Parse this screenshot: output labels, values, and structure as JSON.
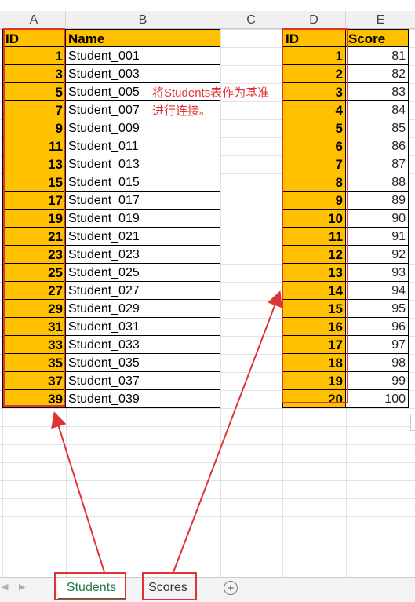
{
  "columns": [
    "A",
    "B",
    "C",
    "D",
    "E"
  ],
  "students": {
    "header_id": "ID",
    "header_name": "Name",
    "rows": [
      {
        "id": "1",
        "name": "Student_001"
      },
      {
        "id": "3",
        "name": "Student_003"
      },
      {
        "id": "5",
        "name": "Student_005"
      },
      {
        "id": "7",
        "name": "Student_007"
      },
      {
        "id": "9",
        "name": "Student_009"
      },
      {
        "id": "11",
        "name": "Student_011"
      },
      {
        "id": "13",
        "name": "Student_013"
      },
      {
        "id": "15",
        "name": "Student_015"
      },
      {
        "id": "17",
        "name": "Student_017"
      },
      {
        "id": "19",
        "name": "Student_019"
      },
      {
        "id": "21",
        "name": "Student_021"
      },
      {
        "id": "23",
        "name": "Student_023"
      },
      {
        "id": "25",
        "name": "Student_025"
      },
      {
        "id": "27",
        "name": "Student_027"
      },
      {
        "id": "29",
        "name": "Student_029"
      },
      {
        "id": "31",
        "name": "Student_031"
      },
      {
        "id": "33",
        "name": "Student_033"
      },
      {
        "id": "35",
        "name": "Student_035"
      },
      {
        "id": "37",
        "name": "Student_037"
      },
      {
        "id": "39",
        "name": "Student_039"
      }
    ]
  },
  "scores": {
    "header_id": "ID",
    "header_score": "Score",
    "rows": [
      {
        "id": "1",
        "score": "81"
      },
      {
        "id": "2",
        "score": "82"
      },
      {
        "id": "3",
        "score": "83"
      },
      {
        "id": "4",
        "score": "84"
      },
      {
        "id": "5",
        "score": "85"
      },
      {
        "id": "6",
        "score": "86"
      },
      {
        "id": "7",
        "score": "87"
      },
      {
        "id": "8",
        "score": "88"
      },
      {
        "id": "9",
        "score": "89"
      },
      {
        "id": "10",
        "score": "90"
      },
      {
        "id": "11",
        "score": "91"
      },
      {
        "id": "12",
        "score": "92"
      },
      {
        "id": "13",
        "score": "93"
      },
      {
        "id": "14",
        "score": "94"
      },
      {
        "id": "15",
        "score": "95"
      },
      {
        "id": "16",
        "score": "96"
      },
      {
        "id": "17",
        "score": "97"
      },
      {
        "id": "18",
        "score": "98"
      },
      {
        "id": "19",
        "score": "99"
      },
      {
        "id": "20",
        "score": "100"
      }
    ]
  },
  "annotation": {
    "line1": "将Students表作为基准",
    "line2": "进行连接。"
  },
  "sheet_tabs": {
    "students": "Students",
    "scores": "Scores",
    "add_icon": "plus-circle-icon"
  },
  "colors": {
    "highlight": "#ffc000",
    "annotation_red": "#e03434",
    "active_tab_text": "#217346"
  }
}
